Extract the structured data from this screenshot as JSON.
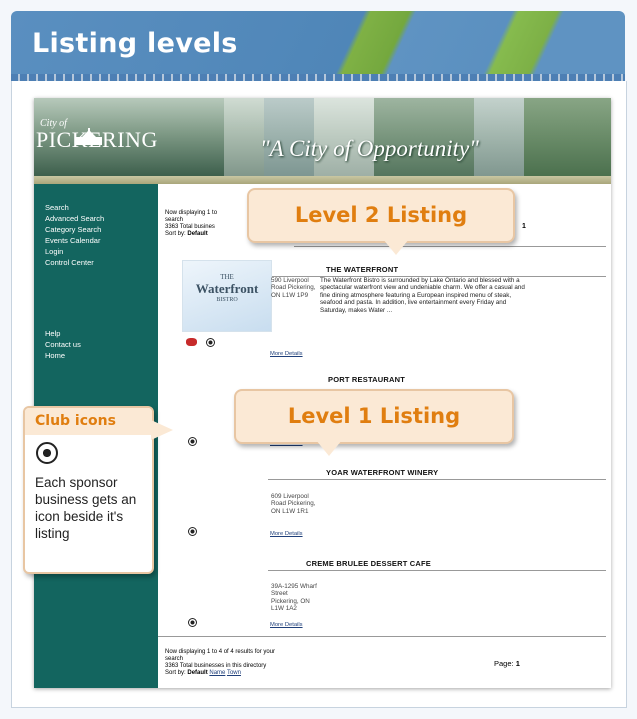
{
  "slide": {
    "title": "Listing levels"
  },
  "site": {
    "logo": {
      "city_of": "City of",
      "name": "PICKERING"
    },
    "slogan": "\"A City of Opportunity\"",
    "nav_primary": [
      "Search",
      "Advanced Search",
      "Category Search",
      "Events Calendar",
      "Login",
      "Control Center"
    ],
    "nav_secondary": [
      "Help",
      "Contact us",
      "Home"
    ],
    "results_top": {
      "line1": "Now displaying 1 to",
      "line2": "search",
      "line3": "3363 Total busines",
      "sort_label": "Sort by:",
      "sort_default": "Default",
      "page_value": "1"
    },
    "listings": [
      {
        "name": "THE WATERFRONT",
        "thumb_line1": "THE",
        "thumb_line2": "Waterfront",
        "thumb_line3": "BISTRO",
        "address": "590 Liverpool Road Pickering, ON L1W 1P9",
        "description": "The Waterfront Bistro is surrounded by Lake Ontario and blessed with a spectacular waterfront view and undeniable charm. We offer a casual and fine dining atmosphere featuring a European inspired menu of steak, seafood and pasta. In addition, live entertainment every Friday and Saturday, makes Water ...",
        "more": "More Details"
      },
      {
        "name": "PORT RESTAURANT",
        "more": "More Details"
      },
      {
        "name": "YOAR WATERFRONT WINERY",
        "address": "609 Liverpool Road Pickering, ON L1W 1R1",
        "more": "More Details"
      },
      {
        "name": "CREME BRULEE DESSERT CAFE",
        "address": "39A-1295 Wharf Street Pickering, ON L1W 1A2",
        "more": "More Details"
      }
    ],
    "results_bottom": {
      "line1": "Now displaying 1 to 4 of 4 results for your",
      "line2": "search",
      "line3": "3363 Total businesses in this directory",
      "sort_label": "Sort by:",
      "sort_default": "Default",
      "sort_name": "Name",
      "sort_town": "Town",
      "page_label": "Page:",
      "page_value": "1"
    }
  },
  "callouts": {
    "level2": "Level 2  Listing",
    "level1": "Level 1  Listing",
    "club_title": "Club icons",
    "club_text": "Each sponsor business gets an icon beside it's listing"
  },
  "icons": {
    "sponsor": "soccer-ball-icon",
    "rose": "rose-icon"
  },
  "colors": {
    "sidebar": "#13655f",
    "callout_text": "#e07e10",
    "callout_fill": "#fbe9d5"
  }
}
